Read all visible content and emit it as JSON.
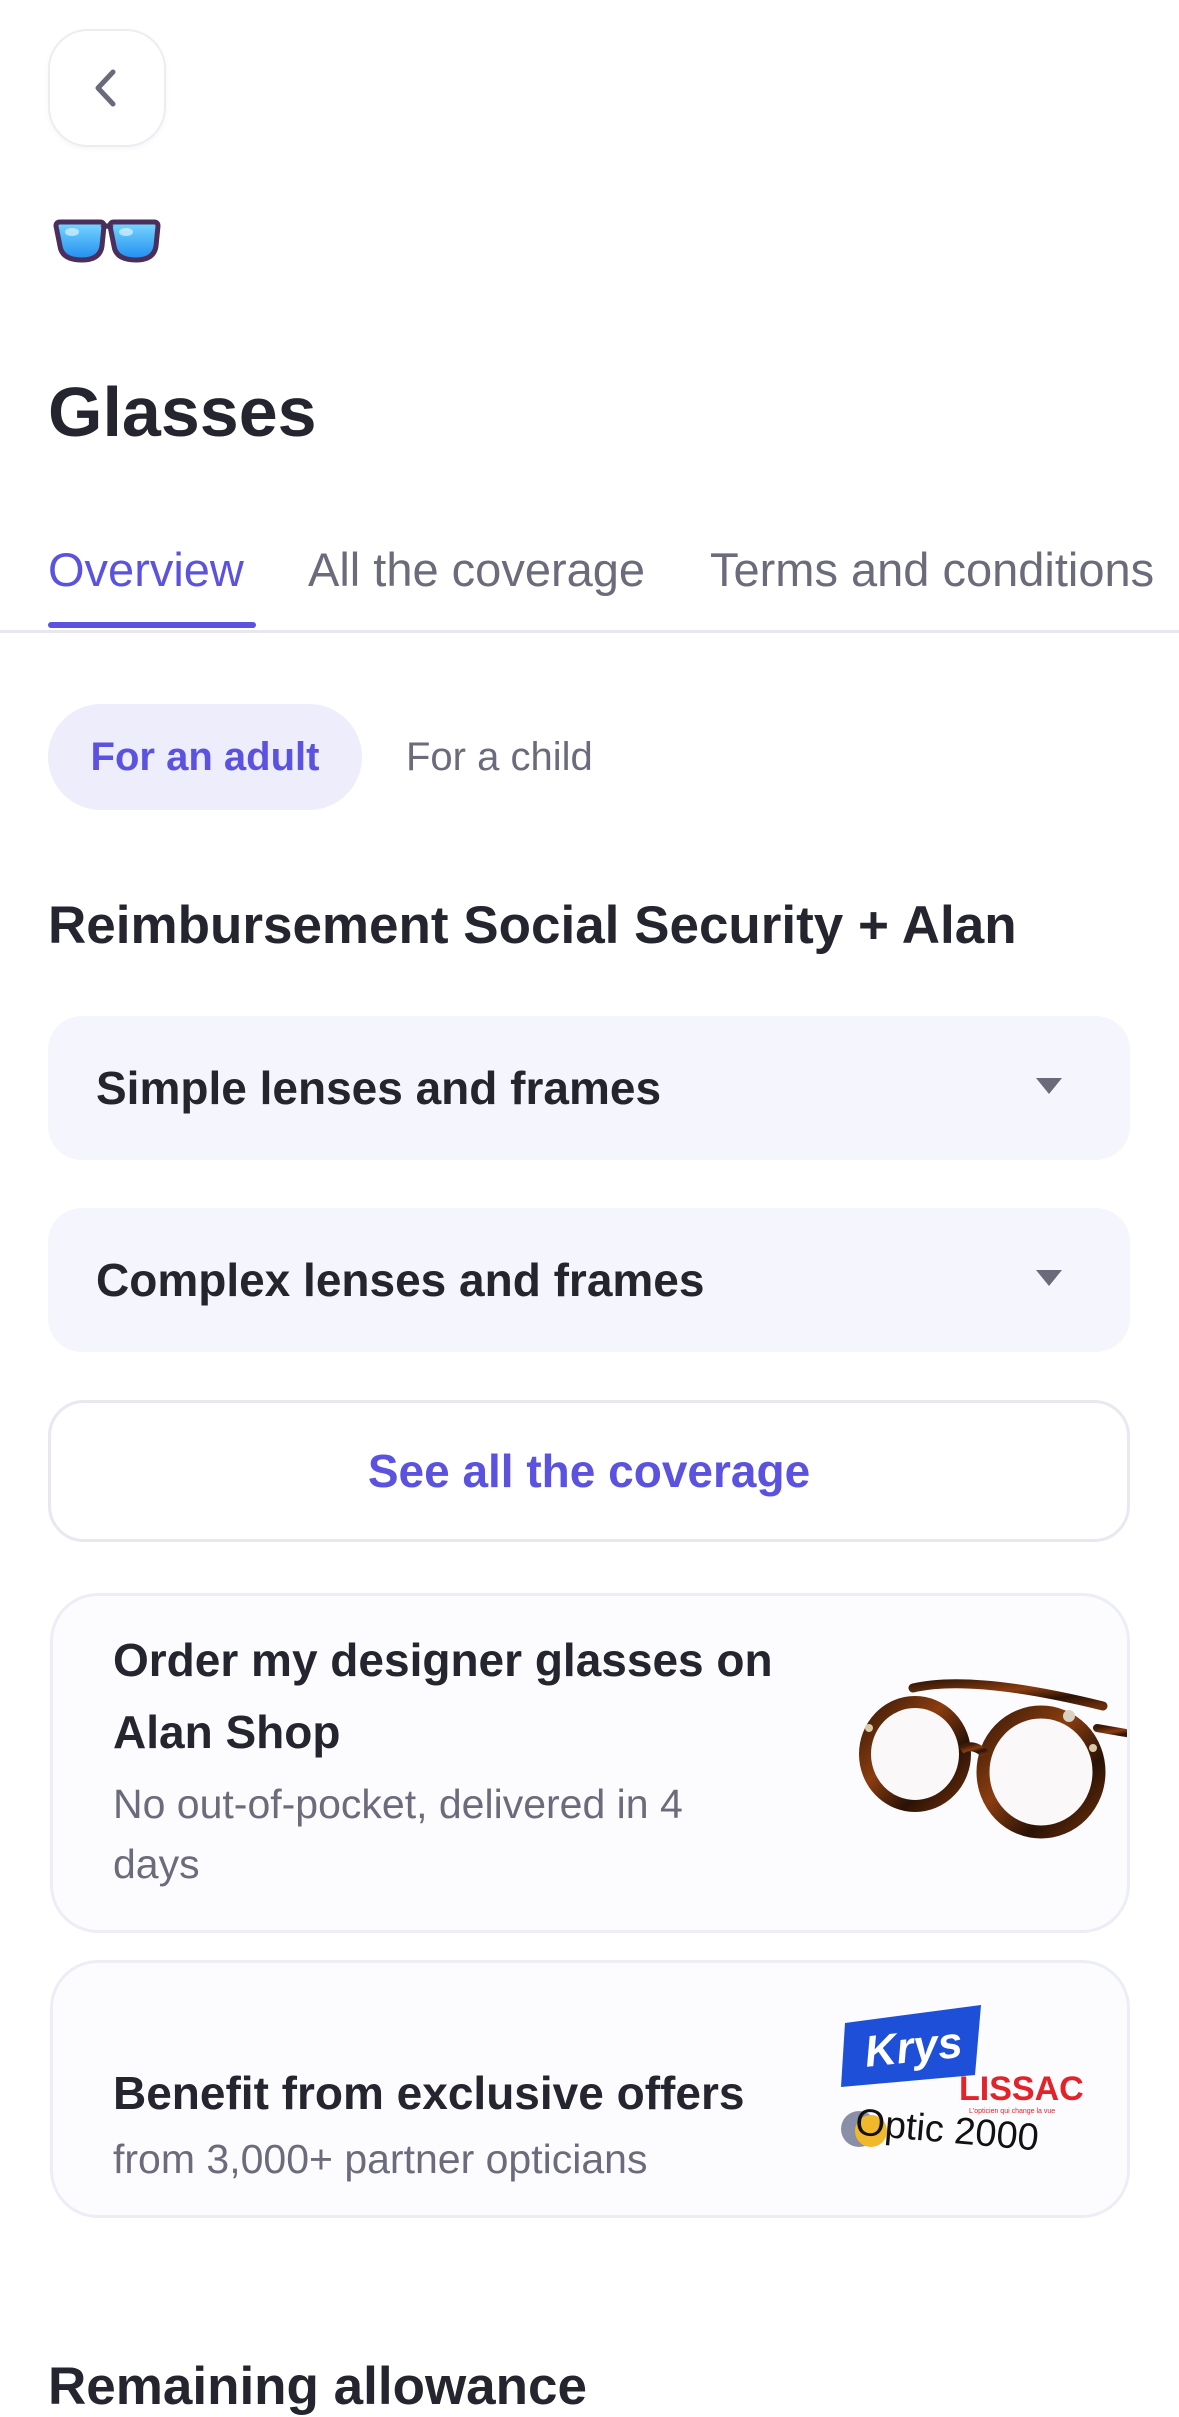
{
  "header": {
    "back_icon": "chevron-left-icon",
    "category_icon": "glasses-icon",
    "title": "Glasses"
  },
  "tabs": [
    {
      "label": "Overview",
      "active": true
    },
    {
      "label": "All the coverage",
      "active": false
    },
    {
      "label": "Terms and conditions",
      "active": false
    }
  ],
  "toggle": {
    "options": [
      {
        "label": "For an adult",
        "selected": true
      },
      {
        "label": "For a child",
        "selected": false
      }
    ]
  },
  "section_title": "Reimbursement Social Security + Alan",
  "accordions": [
    {
      "label": "Simple lenses and frames",
      "icon": "caret-down-icon"
    },
    {
      "label": "Complex lenses and frames",
      "icon": "caret-down-icon"
    }
  ],
  "see_all_button": "See all the coverage",
  "shop_card": {
    "title_line1": "Order my designer glasses on",
    "title_line2": "Alan Shop",
    "sub_line1": "No out-of-pocket, delivered in 4",
    "sub_line2": "days"
  },
  "offers_card": {
    "title": "Benefit from exclusive offers",
    "subtitle": "from 3,000+ partner opticians",
    "logos": {
      "krys": "Krys",
      "lissac": "LISSAC",
      "lissac_tagline": "L'opticien qui change la vue",
      "optic2000": "Optic 2000"
    }
  },
  "remaining_title": "Remaining allowance",
  "colors": {
    "accent": "#5b52e0",
    "accent_soft": "#ededfc",
    "card_bg": "#f5f6fd",
    "krys_blue": "#1d4fd8",
    "lissac_red": "#e2232a"
  }
}
